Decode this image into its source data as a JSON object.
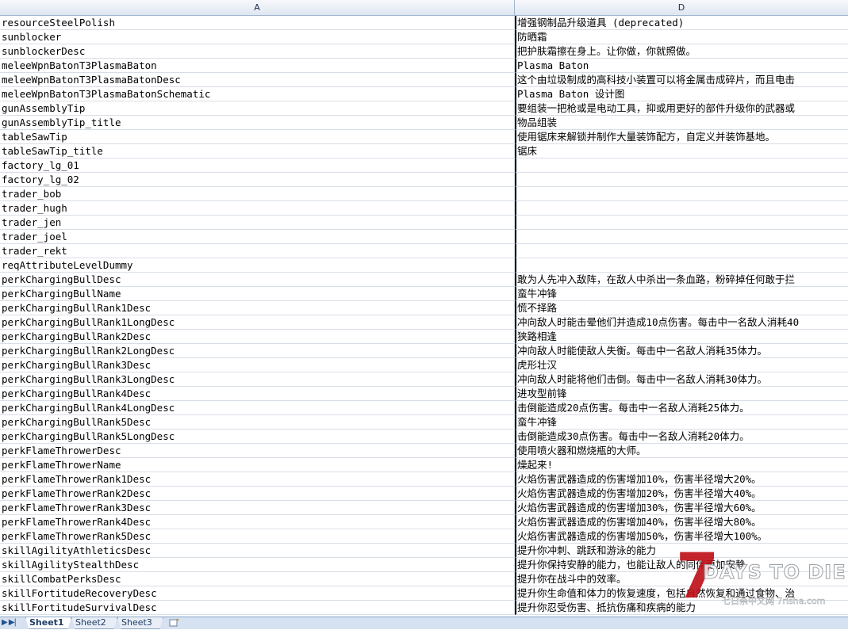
{
  "columns": {
    "a": "A",
    "d": "D"
  },
  "rows": [
    {
      "key": "resourceSteelPolish",
      "value": "增强钢制品升级道具 (deprecated)"
    },
    {
      "key": "sunblocker",
      "value": "防晒霜"
    },
    {
      "key": "sunblockerDesc",
      "value": "把护肤霜擦在身上。让你做，你就照做。"
    },
    {
      "key": "meleeWpnBatonT3PlasmaBaton",
      "value": "Plasma Baton"
    },
    {
      "key": "meleeWpnBatonT3PlasmaBatonDesc",
      "value": "这个由垃圾制成的高科技小装置可以将金属击成碎片，而且电击"
    },
    {
      "key": "meleeWpnBatonT3PlasmaBatonSchematic",
      "value": "Plasma Baton 设计图"
    },
    {
      "key": "gunAssemblyTip",
      "value": "要组装一把枪或是电动工具，抑或用更好的部件升级你的武器或"
    },
    {
      "key": "gunAssemblyTip_title",
      "value": "物品组装"
    },
    {
      "key": "tableSawTip",
      "value": "使用锯床来解锁并制作大量装饰配方，自定义并装饰基地。"
    },
    {
      "key": "tableSawTip_title",
      "value": "锯床"
    },
    {
      "key": "factory_lg_01",
      "value": ""
    },
    {
      "key": "factory_lg_02",
      "value": ""
    },
    {
      "key": "trader_bob",
      "value": ""
    },
    {
      "key": "trader_hugh",
      "value": ""
    },
    {
      "key": "trader_jen",
      "value": ""
    },
    {
      "key": "trader_joel",
      "value": ""
    },
    {
      "key": "trader_rekt",
      "value": ""
    },
    {
      "key": "reqAttributeLevelDummy",
      "value": ""
    },
    {
      "key": "perkChargingBullDesc",
      "value": "敢为人先冲入敌阵，在敌人中杀出一条血路，粉碎掉任何敢于拦"
    },
    {
      "key": "perkChargingBullName",
      "value": "蛮牛冲锋"
    },
    {
      "key": "perkChargingBullRank1Desc",
      "value": "慌不择路"
    },
    {
      "key": "perkChargingBullRank1LongDesc",
      "value": "冲向敌人时能击晕他们并造成10点伤害。每击中一名敌人消耗40"
    },
    {
      "key": "perkChargingBullRank2Desc",
      "value": "狭路相逢"
    },
    {
      "key": "perkChargingBullRank2LongDesc",
      "value": "冲向敌人时能使敌人失衡。每击中一名敌人消耗35体力。"
    },
    {
      "key": "perkChargingBullRank3Desc",
      "value": "虎形壮汉"
    },
    {
      "key": "perkChargingBullRank3LongDesc",
      "value": "冲向敌人时能将他们击倒。每击中一名敌人消耗30体力。"
    },
    {
      "key": "perkChargingBullRank4Desc",
      "value": "进攻型前锋"
    },
    {
      "key": "perkChargingBullRank4LongDesc",
      "value": "击倒能造成20点伤害。每击中一名敌人消耗25体力。"
    },
    {
      "key": "perkChargingBullRank5Desc",
      "value": "蛮牛冲锋"
    },
    {
      "key": "perkChargingBullRank5LongDesc",
      "value": "击倒能造成30点伤害。每击中一名敌人消耗20体力。"
    },
    {
      "key": "perkFlameThrowerDesc",
      "value": "使用喷火器和燃烧瓶的大师。"
    },
    {
      "key": "perkFlameThrowerName",
      "value": "燥起来!"
    },
    {
      "key": "perkFlameThrowerRank1Desc",
      "value": "火焰伤害武器造成的伤害增加10%，伤害半径增大20%。"
    },
    {
      "key": "perkFlameThrowerRank2Desc",
      "value": "火焰伤害武器造成的伤害增加20%，伤害半径增大40%。"
    },
    {
      "key": "perkFlameThrowerRank3Desc",
      "value": "火焰伤害武器造成的伤害增加30%，伤害半径增大60%。"
    },
    {
      "key": "perkFlameThrowerRank4Desc",
      "value": "火焰伤害武器造成的伤害增加40%，伤害半径增大80%。"
    },
    {
      "key": "perkFlameThrowerRank5Desc",
      "value": "火焰伤害武器造成的伤害增加50%，伤害半径增大100%。"
    },
    {
      "key": "skillAgilityAthleticsDesc",
      "value": "提升你冲刺、跳跃和游泳的能力"
    },
    {
      "key": "skillAgilityStealthDesc",
      "value": "提升你保持安静的能力，也能让敌人的同伴更加安静"
    },
    {
      "key": "skillCombatPerksDesc",
      "value": "提升你在战斗中的效率。"
    },
    {
      "key": "skillFortitudeRecoveryDesc",
      "value": "提升你生命值和体力的恢复速度，包括自然恢复和通过食物、治"
    },
    {
      "key": "skillFortitudeSurvivalDesc",
      "value": "提升你忍受伤害、抵抗伤痛和疾病的能力"
    }
  ],
  "tabs": [
    {
      "label": "Sheet1",
      "active": true
    },
    {
      "label": "Sheet2",
      "active": false
    },
    {
      "label": "Sheet3",
      "active": false
    }
  ],
  "tab_nav": "▶ ▶|",
  "new_sheet_icon": "new-sheet-icon",
  "watermark": {
    "digit": "7",
    "title": "DAYS TO DIE",
    "site": "七日杀中文网 7risha.com"
  },
  "colors": {
    "header_bg": "#dfe6f0",
    "grid": "#d8dee6",
    "tabbar": "#d6e2f1",
    "watermark_red": "#c0121a"
  }
}
